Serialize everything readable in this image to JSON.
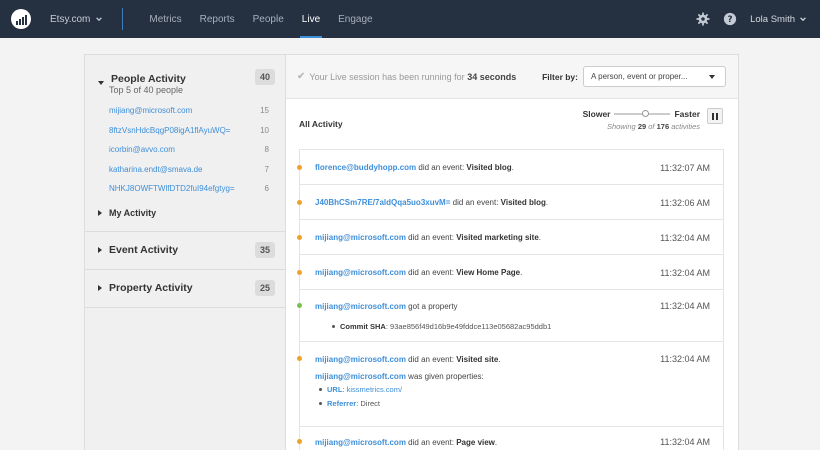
{
  "nav": {
    "account": "Etsy.com",
    "items": [
      {
        "label": "Metrics"
      },
      {
        "label": "Reports"
      },
      {
        "label": "People"
      },
      {
        "label": "Live"
      },
      {
        "label": "Engage"
      }
    ],
    "active": "Live",
    "user": "Lola Smith",
    "colors": {
      "bar": "#253040",
      "accent": "#3e8fd9"
    }
  },
  "sidebar": {
    "people": {
      "title": "People Activity",
      "count": "40",
      "subtitle": "Top 5 of 40 people",
      "items": [
        {
          "email": "mijiang@microsoft.com",
          "count": "15"
        },
        {
          "email": "8ftzVsnHdcBqgP08igA1flAyuWQ=",
          "count": "10"
        },
        {
          "email": "icorbin@avvo.com",
          "count": "8"
        },
        {
          "email": "katharina.endt@smava.de",
          "count": "7"
        },
        {
          "email": "NHKJ8OWFTWlfDTD2fuI94efgtyg=",
          "count": "6"
        }
      ],
      "my_activity": "My Activity"
    },
    "event": {
      "title": "Event Activity",
      "count": "35"
    },
    "property": {
      "title": "Property Activity",
      "count": "25"
    }
  },
  "main": {
    "banner": {
      "prefix": "Your Live session has been running for",
      "duration": "34 seconds"
    },
    "filter": {
      "label": "Filter by:",
      "value": "A person, event or proper..."
    },
    "all_activity": "All Activity",
    "speed": {
      "slower": "Slower",
      "faster": "Faster",
      "position": 0.55
    },
    "showing": {
      "prefix": "Showing",
      "shown": "29",
      "of": "of",
      "total": "176",
      "suffix": "activities"
    },
    "events": [
      {
        "who": "florence@buddyhopp.com",
        "verb": "did an event:",
        "what": "Visited blog",
        "end": ".",
        "time": "11:32:07 AM",
        "color": "#f0a12b"
      },
      {
        "who": "J40BhCSm7RE/7aldQqa5uo3xuvM=",
        "verb": "did an event:",
        "what": "Visited blog",
        "end": ".",
        "time": "11:32:06 AM",
        "color": "#f0a12b"
      },
      {
        "who": "mijiang@microsoft.com",
        "verb": "did an event:",
        "what": "Visited marketing site",
        "end": ".",
        "time": "11:32:04 AM",
        "color": "#f0a12b"
      },
      {
        "who": "mijiang@microsoft.com",
        "verb": "did an event:",
        "what": "View Home Page",
        "end": ".",
        "time": "11:32:04 AM",
        "color": "#f0a12b"
      },
      {
        "who": "mijiang@microsoft.com",
        "verb": "got a property",
        "what": "",
        "end": "",
        "time": "11:32:04 AM",
        "color": "#7cc04b",
        "props": [
          {
            "key": "Commit SHA",
            "sep": ":",
            "val": "93ae856f49d16b9e49fddce113e05682ac95ddb1"
          }
        ]
      },
      {
        "who": "mijiang@microsoft.com",
        "verb": "did an event:",
        "what": "Visited site",
        "end": ".",
        "time": "11:32:04 AM",
        "color": "#f0a12b",
        "given_who": "mijiang@microsoft.com",
        "given_text": "was given properties:",
        "props": [
          {
            "key": "URL",
            "sep": ":",
            "val": "kissmetrics.com/"
          },
          {
            "key": "Referrer",
            "sep": ":",
            "val": "Direct"
          }
        ]
      },
      {
        "who": "mijiang@microsoft.com",
        "verb": "did an event:",
        "what": "Page view",
        "end": ".",
        "time": "11:32:04 AM",
        "color": "#f0a12b"
      }
    ]
  }
}
